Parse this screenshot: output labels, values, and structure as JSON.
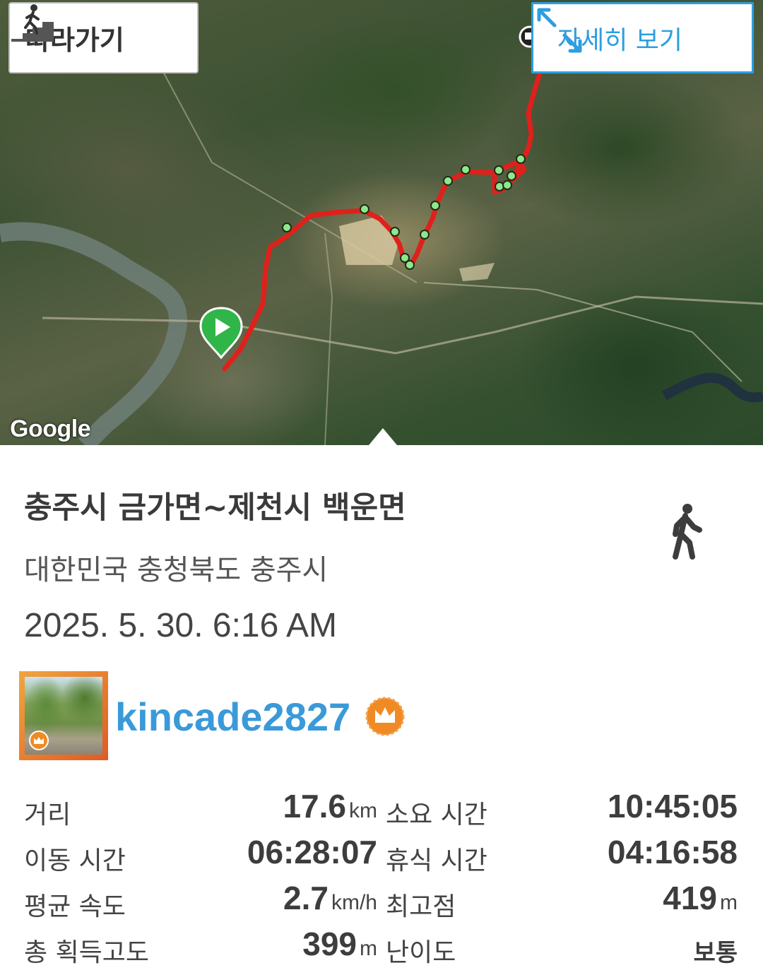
{
  "map": {
    "follow_label": "따라가기",
    "detail_label": "자세히 보기",
    "provider_logo": "Google",
    "follow_icon": "hiker-stairs-icon",
    "detail_icon": "expand-arrows-icon",
    "route_color": "#e0201b",
    "waypoint_color": "#8de88a",
    "start_marker_color": "#2fb548"
  },
  "track": {
    "title": "충주시 금가면~제천시 백운면",
    "location": "대한민국 충청북도 충주시",
    "datetime": "2025. 5. 30. 6:16 AM",
    "activity_icon": "walking-person-icon"
  },
  "user": {
    "name": "kincade2827",
    "badge_icon": "crown-icon",
    "accent": "#3a9ad9"
  },
  "stats": {
    "distance": {
      "label": "거리",
      "value": "17.6",
      "unit": "km"
    },
    "total_time": {
      "label": "소요 시간",
      "value": "10:45:05"
    },
    "moving_time": {
      "label": "이동 시간",
      "value": "06:28:07"
    },
    "rest_time": {
      "label": "휴식 시간",
      "value": "04:16:58"
    },
    "avg_speed": {
      "label": "평균 속도",
      "value": "2.7",
      "unit": "km/h"
    },
    "max_elevation": {
      "label": "최고점",
      "value": "419",
      "unit": "m"
    },
    "total_ascent": {
      "label": "총 획득고도",
      "value": "399",
      "unit": "m"
    },
    "difficulty": {
      "label": "난이도",
      "value": "보통"
    }
  }
}
